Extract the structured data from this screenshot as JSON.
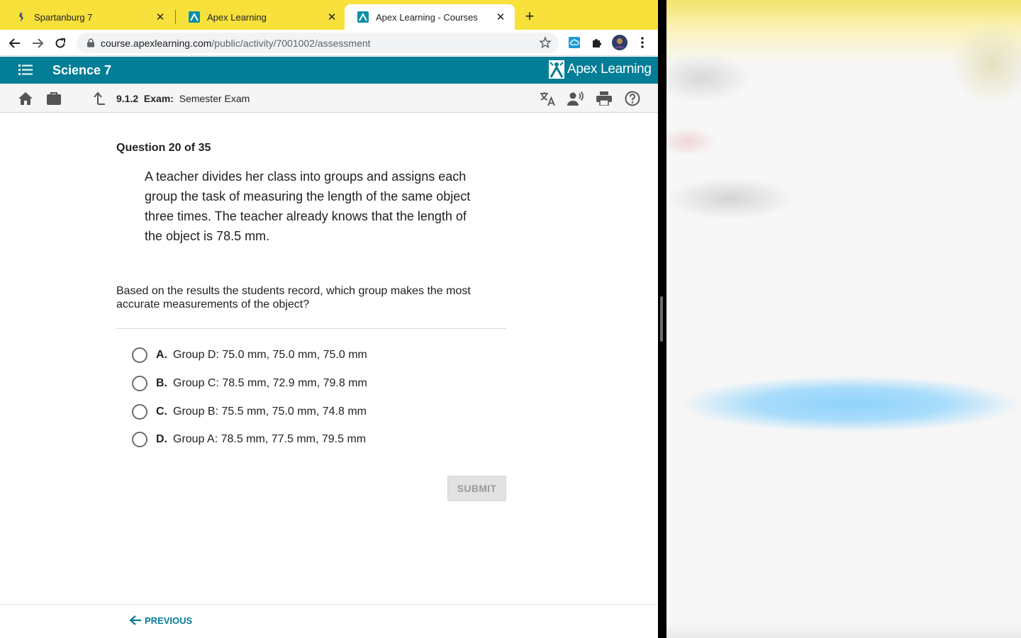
{
  "browser": {
    "tabs": [
      {
        "title": "Spartanburg 7",
        "active": false
      },
      {
        "title": "Apex Learning",
        "active": false
      },
      {
        "title": "Apex Learning - Courses",
        "active": true
      }
    ],
    "url_host": "course.apexlearning.com",
    "url_path": "/public/activity/7001002/assessment"
  },
  "course": {
    "title": "Science 7",
    "brand": "Apex Learning"
  },
  "breadcrumb": {
    "section": "9.1.2",
    "type": "Exam:",
    "name": "Semester Exam"
  },
  "question": {
    "number_label": "Question 20 of 35",
    "stem": "A teacher divides her class into groups and assigns each group the task of measuring the length of the same object three times. The teacher already knows that the length of the object is 78.5 mm.",
    "prompt": "Based on the results the students record, which group makes the most accurate measurements of the object?",
    "options": [
      {
        "letter": "A.",
        "text": "Group D: 75.0 mm, 75.0 mm, 75.0 mm",
        "selected": false
      },
      {
        "letter": "B.",
        "text": "Group C: 78.5 mm, 72.9 mm, 79.8 mm",
        "selected": false
      },
      {
        "letter": "C.",
        "text": "Group B: 75.5 mm, 75.0 mm, 74.8 mm",
        "selected": false
      },
      {
        "letter": "D.",
        "text": "Group A: 78.5 mm, 77.5 mm, 79.5 mm",
        "selected": false
      }
    ],
    "submit_label": "SUBMIT"
  },
  "footer": {
    "previous_label": "PREVIOUS"
  },
  "colors": {
    "tabstrip": "#f7e13a",
    "accent": "#047d96"
  }
}
